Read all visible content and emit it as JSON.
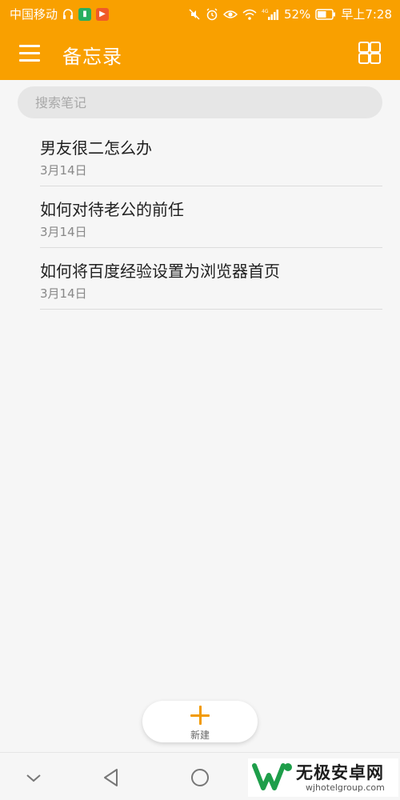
{
  "status_bar": {
    "carrier": "中国移动",
    "signal_label": "4G",
    "battery": "52%",
    "time": "早上7:28"
  },
  "app_bar": {
    "title": "备忘录",
    "menu_icon": "hamburger-menu-icon",
    "view_icon": "grid-view-icon"
  },
  "search": {
    "placeholder": "搜索笔记"
  },
  "notes": [
    {
      "title": "男友很二怎么办",
      "date": "3月14日"
    },
    {
      "title": "如何对待老公的前任",
      "date": "3月14日"
    },
    {
      "title": "如何将百度经验设置为浏览器首页",
      "date": "3月14日"
    }
  ],
  "fab": {
    "label": "新建",
    "icon": "plus-icon"
  },
  "navbar": {
    "icons": [
      "hide-keyboard-chevron-icon",
      "back-triangle-icon",
      "home-circle-icon"
    ]
  },
  "watermark": {
    "text": "无极安卓网",
    "url": "wjhotelgroup.com"
  },
  "colors": {
    "accent": "#f9a000",
    "background": "#f6f6f6"
  }
}
